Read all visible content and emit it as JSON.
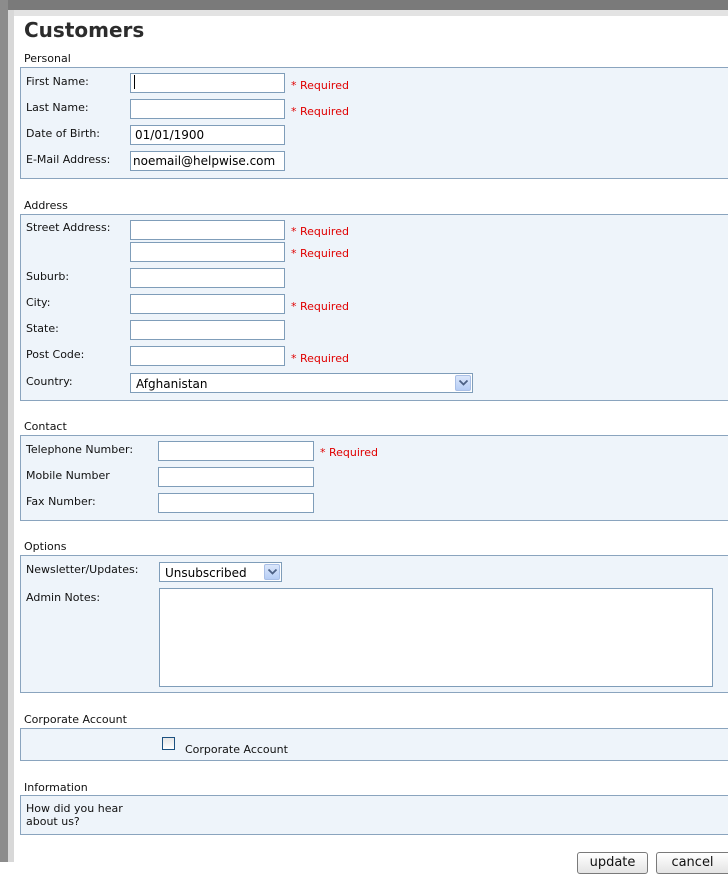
{
  "page": {
    "title": "Customers"
  },
  "personal": {
    "section_label": "Personal",
    "first_name": {
      "label": "First Name:",
      "value": "",
      "required": "* Required"
    },
    "last_name": {
      "label": "Last Name:",
      "value": "",
      "required": "* Required"
    },
    "dob": {
      "label": "Date of Birth:",
      "value": "01/01/1900"
    },
    "email": {
      "label": "E-Mail Address:",
      "value": "noemail@helpwise.com"
    }
  },
  "address": {
    "section_label": "Address",
    "street": {
      "label": "Street Address:",
      "value": "",
      "required": "* Required"
    },
    "street2": {
      "value": "",
      "required": "* Required"
    },
    "suburb": {
      "label": "Suburb:",
      "value": ""
    },
    "city": {
      "label": "City:",
      "value": "",
      "required": "* Required"
    },
    "state": {
      "label": "State:",
      "value": ""
    },
    "postcode": {
      "label": "Post Code:",
      "value": "",
      "required": "* Required"
    },
    "country": {
      "label": "Country:",
      "value": "Afghanistan"
    }
  },
  "contact": {
    "section_label": "Contact",
    "telephone": {
      "label": "Telephone Number:",
      "value": "",
      "required": "* Required"
    },
    "mobile": {
      "label": "Mobile Number",
      "value": ""
    },
    "fax": {
      "label": "Fax Number:",
      "value": ""
    }
  },
  "options": {
    "section_label": "Options",
    "newsletter": {
      "label": "Newsletter/Updates:",
      "value": "Unsubscribed"
    },
    "admin_notes": {
      "label": "Admin Notes:",
      "value": ""
    }
  },
  "corporate": {
    "section_label": "Corporate Account",
    "checkbox_label": "Corporate Account",
    "checked": false
  },
  "information": {
    "section_label": "Information",
    "question_line1": "How did you hear",
    "question_line2": "about us?"
  },
  "actions": {
    "update_label": "update",
    "cancel_label": "cancel"
  },
  "colors": {
    "required": "#e00000",
    "section_bg": "#eef4fa",
    "section_border": "#8aa4be"
  },
  "icons": {
    "dropdown": "chevron-down-icon"
  }
}
